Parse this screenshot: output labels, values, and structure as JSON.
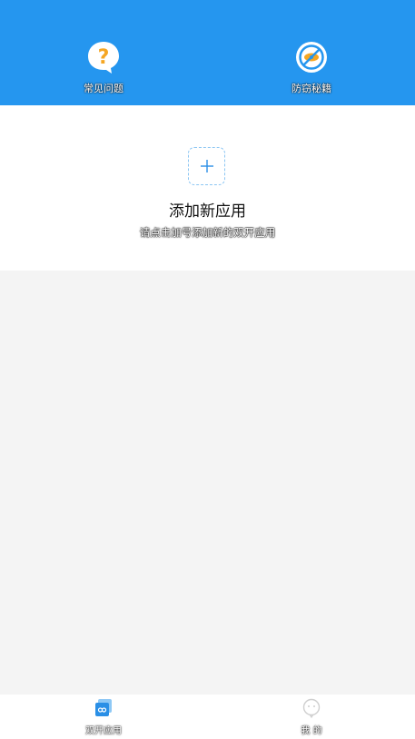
{
  "header": {
    "faq": {
      "label": "常见问题",
      "icon": "question-bubble-icon"
    },
    "anti_ban": {
      "label": "防窃秘籍",
      "icon": "no-eye-icon"
    }
  },
  "empty_state": {
    "title": "添加新应用",
    "subtitle": "请点击加号添加新的双开应用",
    "icon": "plus-icon"
  },
  "bottom_nav": {
    "dual_apps": {
      "label": "双开应用",
      "icon": "dual-app-icon"
    },
    "me": {
      "label": "我 的",
      "icon": "face-icon"
    }
  },
  "colors": {
    "header_bg": "#2596ef",
    "accent": "#2a8fe6",
    "question_orange": "#f5a623"
  }
}
